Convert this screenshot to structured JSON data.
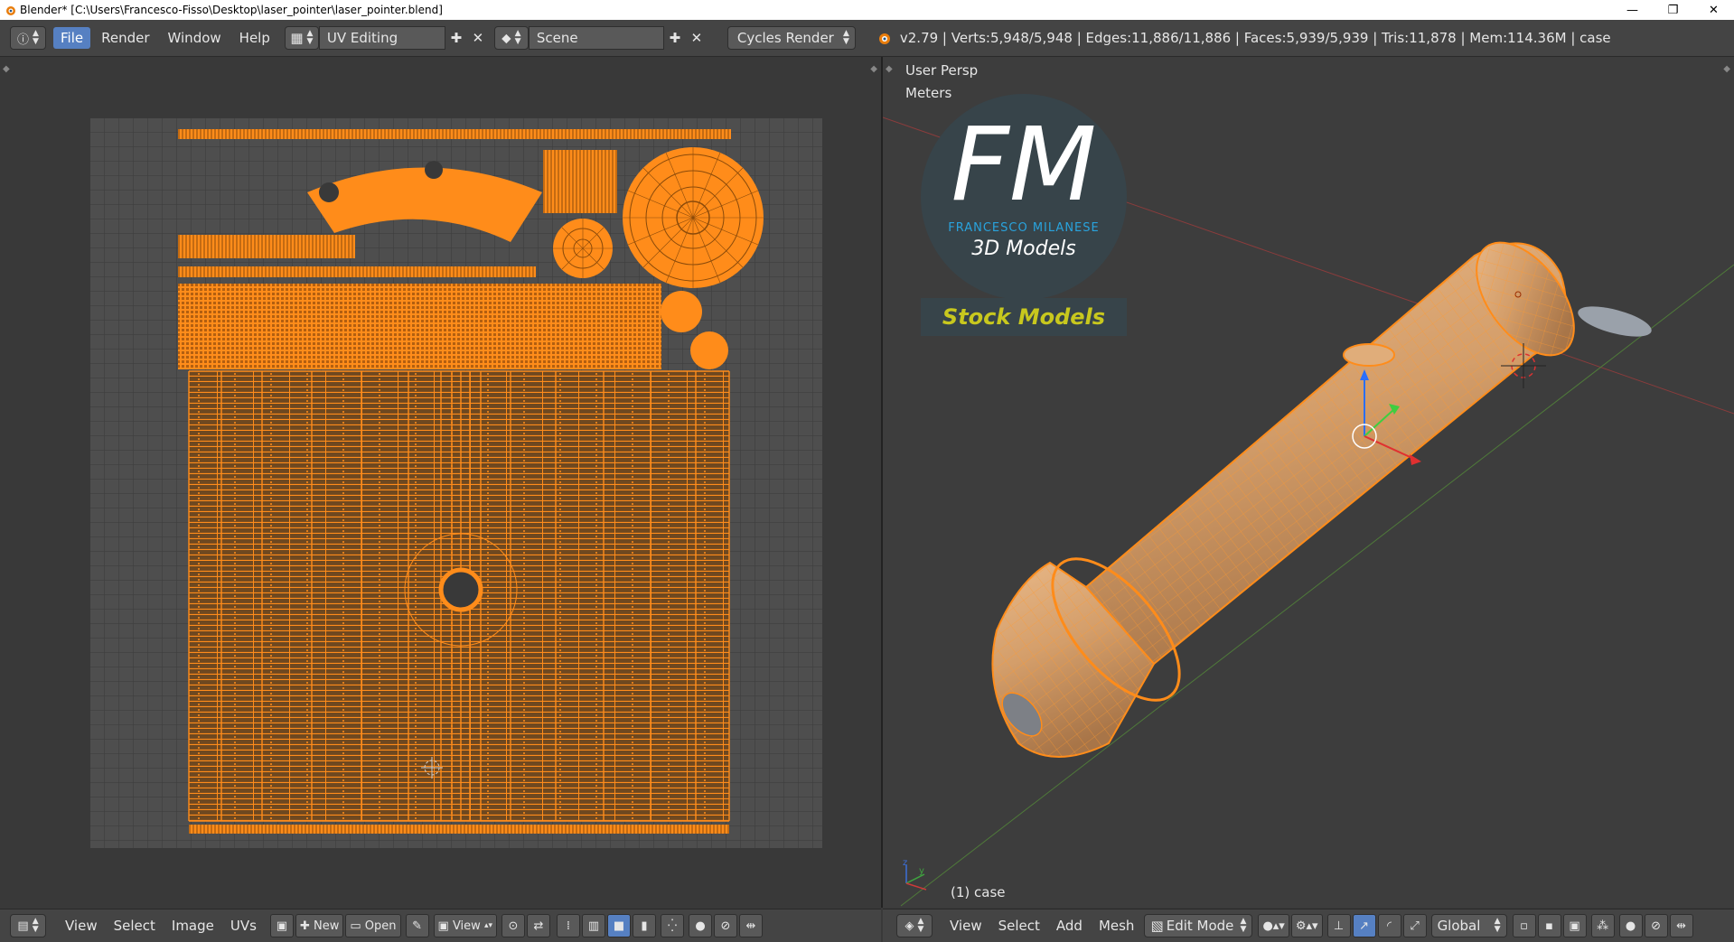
{
  "window": {
    "title": "Blender* [C:\\Users\\Francesco-Fisso\\Desktop\\laser_pointer\\laser_pointer.blend]",
    "minimize": "—",
    "restore": "❐",
    "close": "✕"
  },
  "topbar": {
    "menus": [
      "File",
      "Render",
      "Window",
      "Help"
    ],
    "active_menu": "File",
    "screen_layout": "UV Editing",
    "scene": "Scene",
    "render_engine": "Cycles Render",
    "stats": "v2.79 | Verts:5,948/5,948 | Edges:11,886/11,886 | Faces:5,939/5,939 | Tris:11,878 | Mem:114.36M | case"
  },
  "uv_editor": {
    "menus": [
      "View",
      "Select",
      "Image",
      "UVs"
    ],
    "new_label": "New",
    "open_label": "Open",
    "view_label": "View"
  },
  "viewport": {
    "perspective_label": "User Persp",
    "units_label": "Meters",
    "object_label": "(1) case",
    "menus": [
      "View",
      "Select",
      "Add",
      "Mesh"
    ],
    "mode": "Edit Mode",
    "orientation": "Global"
  },
  "watermark": {
    "logo_initials": "FM",
    "brand_name": "FRANCESCO MILANESE",
    "tagline": "3D Models",
    "stock_label": "Stock Models"
  },
  "colors": {
    "uv_orange": "#ff8c1a",
    "selection_blue": "#5680c2",
    "model_fill": "#d9a06a",
    "watermark_blue": "#29a3dd",
    "stock_yellow": "#c8c81e"
  }
}
